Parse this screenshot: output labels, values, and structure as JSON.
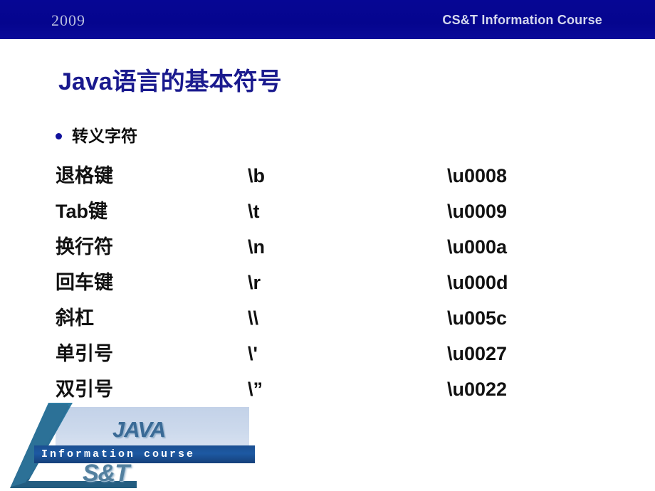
{
  "header": {
    "year": "2009",
    "course_title": "CS&T Information Course"
  },
  "slide": {
    "title": "Java语言的基本符号",
    "bullet": {
      "marker": "bullet-dot",
      "label": "转义字符"
    }
  },
  "escape_table": {
    "rows": [
      {
        "name": "退格键",
        "sequence": "\\b",
        "unicode": "\\u0008"
      },
      {
        "name": "Tab键",
        "sequence": "\\t",
        "unicode": "\\u0009"
      },
      {
        "name": "换行符",
        "sequence": "\\n",
        "unicode": "\\u000a"
      },
      {
        "name": "回车键",
        "sequence": "\\r",
        "unicode": "\\u000d"
      },
      {
        "name": "斜杠",
        "sequence": "\\\\",
        "unicode": "\\u005c"
      },
      {
        "name": "单引号",
        "sequence": "\\'",
        "unicode": "\\u0027"
      },
      {
        "name": "双引号",
        "sequence": "\\”",
        "unicode": "\\u0022"
      }
    ]
  },
  "logo": {
    "wordmark": "JAVA",
    "band_text": "Information course",
    "sub_mark": "S&T"
  },
  "colors": {
    "header_blue": "#060694",
    "title_navy": "#1a1a8e",
    "bullet_blue": "#11119c",
    "body_black": "#111111",
    "logo_teal": "#2e7498",
    "logo_panel": "#ccd9ec",
    "logo_band": "#1d59a3",
    "header_year_text": "#b9bede",
    "header_title_text": "#d5d8ee"
  }
}
